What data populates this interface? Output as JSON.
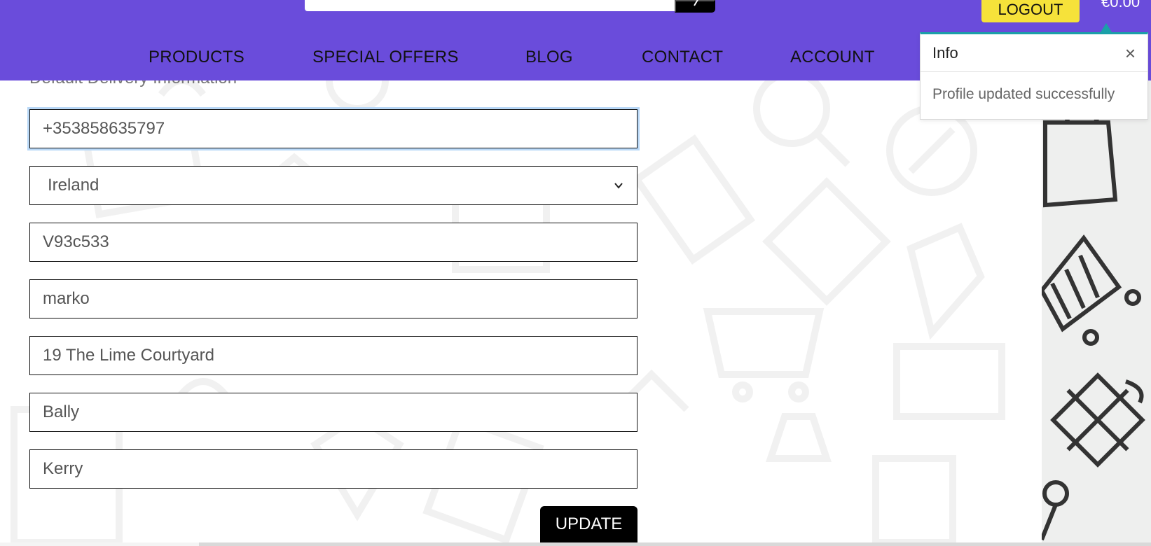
{
  "header": {
    "logout_label": "LOGOUT",
    "cart_total": "€0.00",
    "nav": [
      {
        "label": "PRODUCTS"
      },
      {
        "label": "SPECIAL OFFERS"
      },
      {
        "label": "BLOG"
      },
      {
        "label": "CONTACT"
      },
      {
        "label": "ACCOUNT"
      }
    ],
    "colors": {
      "header_bg": "#6a4cdb",
      "logout_bg": "#f6e23a"
    }
  },
  "form": {
    "heading": "Default Delivery Information",
    "phone": "+353858635797",
    "country": "Ireland",
    "postcode": "V93c533",
    "town": "marko",
    "street": "19 The Lime Courtyard",
    "locality": "Bally",
    "county": "Kerry",
    "update_label": "UPDATE"
  },
  "toast": {
    "title": "Info",
    "message": "Profile updated successfully",
    "accent_color": "#1aa0a8"
  }
}
